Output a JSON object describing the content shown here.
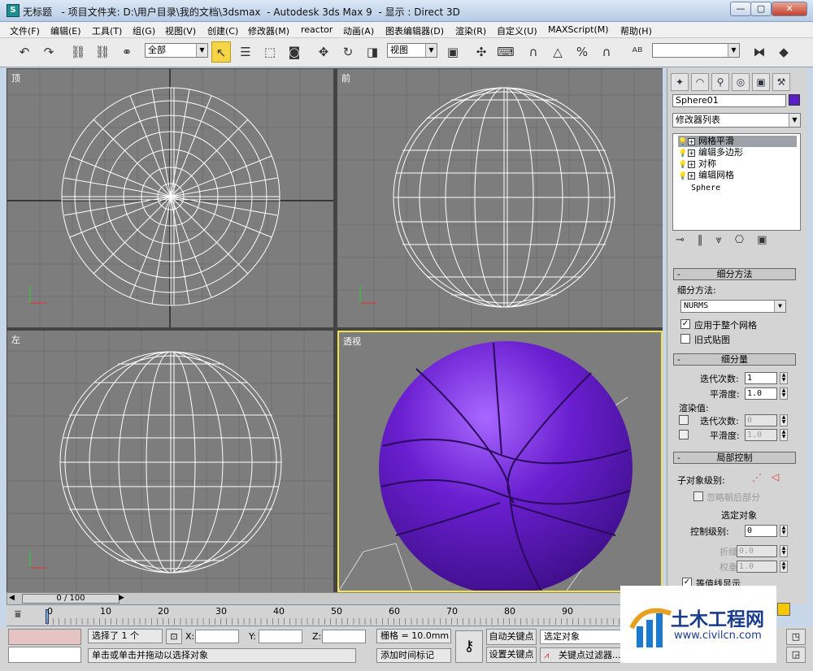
{
  "window": {
    "title": "无标题",
    "project": "- 项目文件夹: D:\\用户目录\\我的文档\\3dsmax",
    "app": "- Autodesk 3ds Max 9",
    "display": "- 显示 : Direct 3D"
  },
  "menu": [
    "文件(F)",
    "编辑(E)",
    "工具(T)",
    "组(G)",
    "视图(V)",
    "创建(C)",
    "修改器(M)",
    "reactor",
    "动画(A)",
    "图表编辑器(D)",
    "渲染(R)",
    "自定义(U)",
    "MAXScript(M)",
    "帮助(H)"
  ],
  "toolbar": {
    "selection_filter": "全部",
    "ref_coord": "视图"
  },
  "viewports": {
    "top": "顶",
    "front": "前",
    "left": "左",
    "perspective": "透视",
    "axis_x": "x",
    "axis_y": "y",
    "axis_z": "z"
  },
  "colors": {
    "ball": "#6a1fd0",
    "object_swatch": "#5a1ec8",
    "highlight": "#f0e24a"
  },
  "command_panel": {
    "object_name": "Sphere01",
    "modifier_list": "修改器列表",
    "stack": [
      "网格平滑",
      "编辑多边形",
      "对称",
      "编辑网格"
    ],
    "base_object": "Sphere",
    "subdivision_method": {
      "header": "细分方法",
      "label": "细分方法:",
      "value": "NURMS",
      "apply_whole_mesh": "应用于整个网格",
      "old_style_mapping": "旧式贴图"
    },
    "subdivision_amount": {
      "header": "细分量",
      "iterations_label": "迭代次数:",
      "iterations": "1",
      "smoothness_label": "平滑度:",
      "smoothness": "1.0",
      "render_values": "渲染值:",
      "r_iterations_label": "迭代次数:",
      "r_iterations": "0",
      "r_smoothness_label": "平滑度:",
      "r_smoothness": "1.0"
    },
    "local_control": {
      "header": "局部控制",
      "sublevel": "子对象级别:",
      "ignore_backfacing": "忽略朝后部分",
      "select_object": "选定对象",
      "control_level_label": "控制级别:",
      "control_level": "0",
      "crease_label": "折缝:",
      "crease": "0.0",
      "weight_label": "权重:",
      "weight": "1.0",
      "isoline_display": "等值线显示"
    }
  },
  "timeline": {
    "frame": "0 / 100",
    "ticks": [
      "0",
      "10",
      "20",
      "30",
      "40",
      "50",
      "60",
      "70",
      "80",
      "90"
    ]
  },
  "status": {
    "selected": "选择了 1 个",
    "x_label": "X:",
    "y_label": "Y:",
    "z_label": "Z:",
    "grid": "栅格 = 10.0mm",
    "auto_key": "自动关键点",
    "set_key": "设置关键点",
    "selected_object": "选定对象",
    "key_filters": "关键点过滤器...",
    "prompt": "单击或单击并拖动以选择对象",
    "add_time_tag": "添加时间标记"
  },
  "watermark": {
    "brand": "土木工程网",
    "url": "www.civilcn.com"
  }
}
